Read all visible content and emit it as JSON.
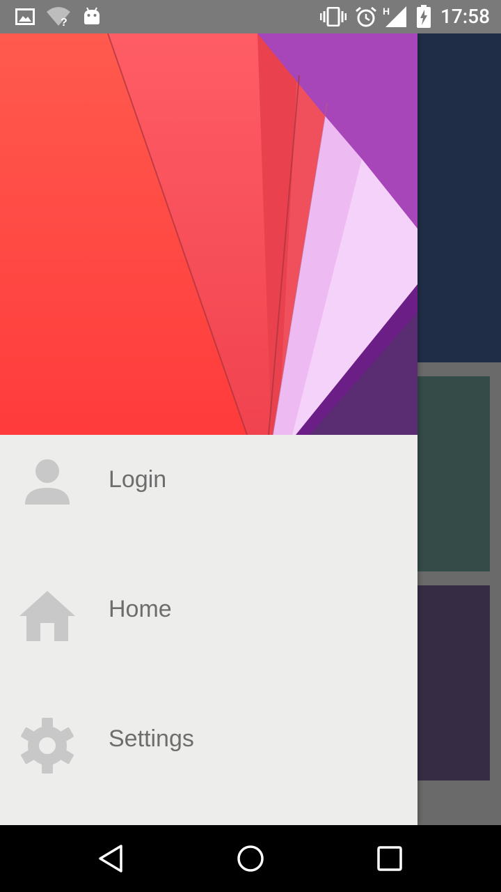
{
  "status_bar": {
    "time": "17:58",
    "network_type": "H",
    "icons": [
      "image-icon",
      "wifi-unknown-icon",
      "android-icon",
      "vibrate-icon",
      "alarm-icon",
      "cell-signal-icon",
      "battery-charging-icon"
    ]
  },
  "drawer": {
    "header_image": "material-abstract-wallpaper",
    "items": [
      {
        "label": "Login",
        "icon": "person-icon"
      },
      {
        "label": "Home",
        "icon": "home-icon"
      },
      {
        "label": "Settings",
        "icon": "gear-icon"
      }
    ]
  },
  "nav_bar": {
    "buttons": [
      "back-icon",
      "home-circle-icon",
      "recents-icon"
    ]
  },
  "colors": {
    "status_bar": "#7a7a7a",
    "drawer_background": "#ededec",
    "menu_text": "#6d6d6d",
    "menu_icon": "#c8c8c8",
    "background_header": "#1f2d47"
  }
}
